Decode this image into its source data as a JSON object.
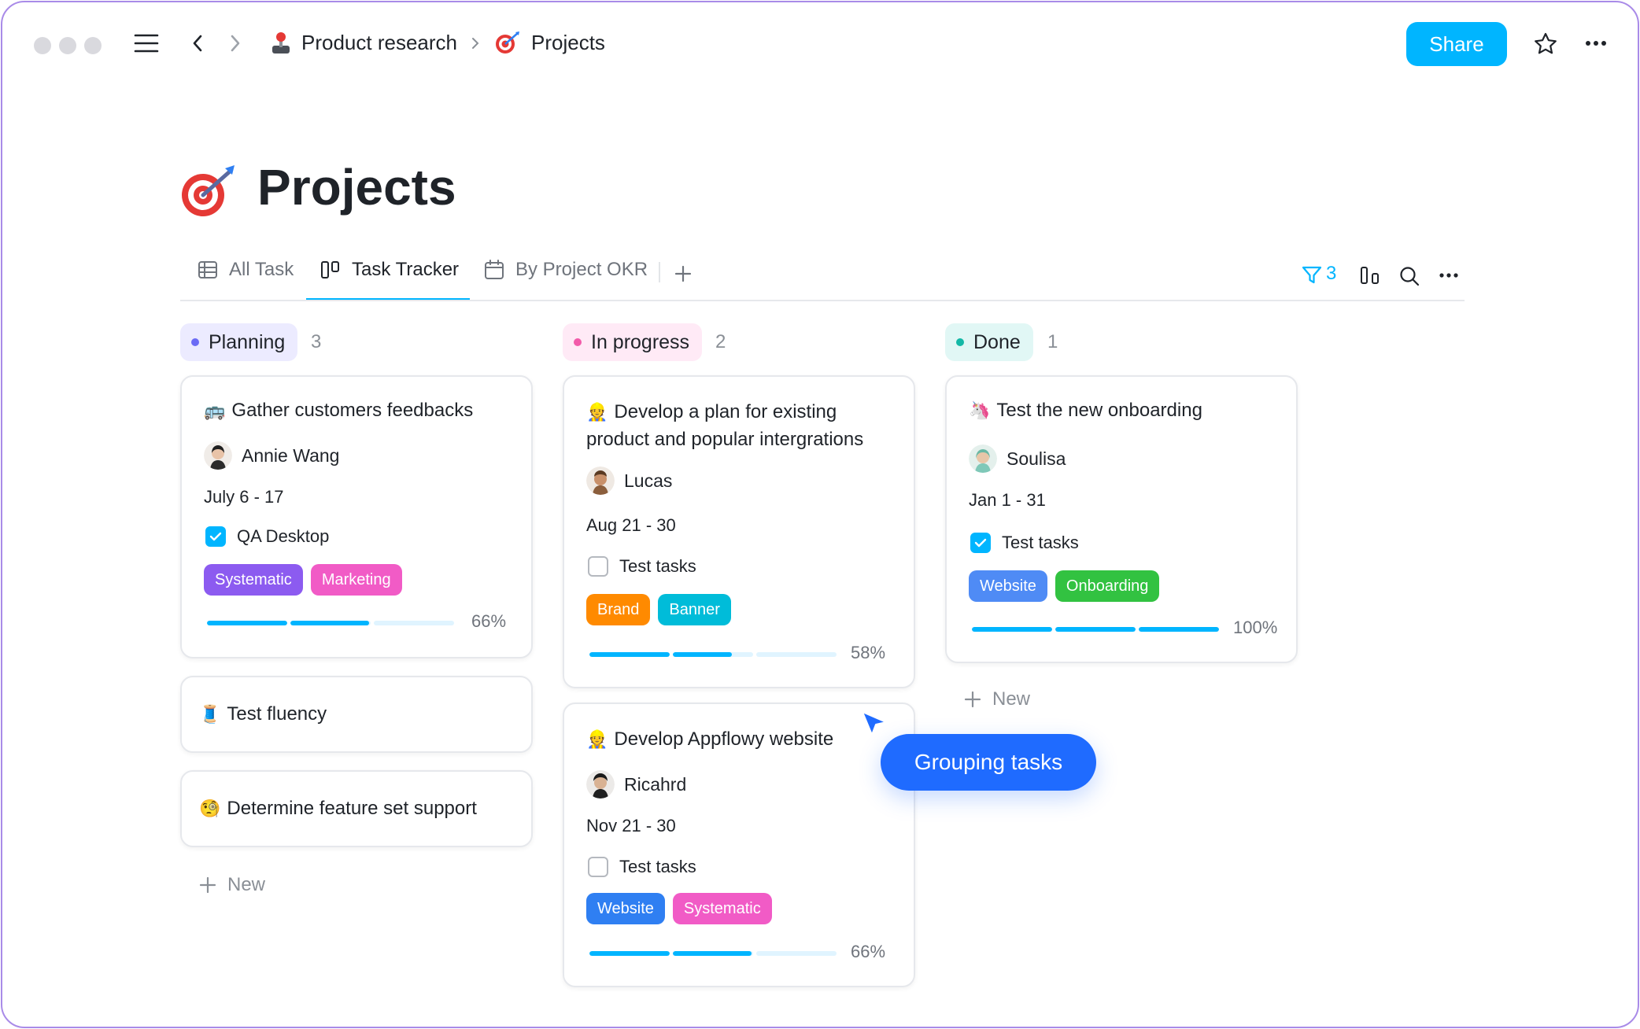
{
  "breadcrumb": {
    "parent": "Product research",
    "current": "Projects"
  },
  "header": {
    "share_label": "Share"
  },
  "page": {
    "title": "Projects"
  },
  "tabs": [
    {
      "label": "All Task",
      "icon": "grid-icon"
    },
    {
      "label": "Task Tracker",
      "icon": "board-icon",
      "active": true
    },
    {
      "label": "By Project OKR",
      "icon": "calendar-icon"
    }
  ],
  "toolbar": {
    "filter_count": "3"
  },
  "colors": {
    "accent": "#00b5ff",
    "planning_bg": "#ecebff",
    "planning_dot": "#6b6bf5",
    "inprogress_bg": "#ffeaf6",
    "inprogress_dot": "#f25aa9",
    "done_bg": "#e1f7f5",
    "done_dot": "#14b8a6"
  },
  "columns": [
    {
      "name": "Planning",
      "count": "3",
      "cards": [
        {
          "emoji": "🚌",
          "title": "Gather customers feedbacks",
          "assignee": "Annie Wang",
          "date": "July 6 - 17",
          "checklist": {
            "label": "QA Desktop",
            "checked": true
          },
          "tags": [
            {
              "label": "Systematic",
              "color": "#8c5bf0"
            },
            {
              "label": "Marketing",
              "color": "#f15bc6"
            }
          ],
          "progress": 0.66,
          "progress_label": "66%"
        },
        {
          "emoji": "🧵",
          "title": "Test fluency"
        },
        {
          "emoji": "🧐",
          "title": "Determine feature set support"
        }
      ],
      "new_label": "New"
    },
    {
      "name": "In progress",
      "count": "2",
      "cards": [
        {
          "emoji": "👷",
          "title_line1": "Develop a plan for existing",
          "title_line2": "product and popular intergrations",
          "assignee": "Lucas",
          "date": "Aug 21 - 30",
          "checklist": {
            "label": "Test tasks",
            "checked": false
          },
          "tags": [
            {
              "label": "Brand",
              "color": "#ff8a00"
            },
            {
              "label": "Banner",
              "color": "#00bcd9"
            }
          ],
          "progress": 0.58,
          "progress_label": "58%"
        },
        {
          "emoji": "👷",
          "title": "Develop Appflowy website",
          "assignee": "Ricahrd",
          "date": "Nov 21 - 30",
          "checklist": {
            "label": "Test tasks",
            "checked": false
          },
          "tags": [
            {
              "label": "Website",
              "color": "#2f7ff2"
            },
            {
              "label": "Systematic",
              "color": "#f15bc6"
            }
          ],
          "progress": 0.66,
          "progress_label": "66%"
        }
      ]
    },
    {
      "name": "Done",
      "count": "1",
      "cards": [
        {
          "emoji": "🦄",
          "title": "Test the new onboarding",
          "assignee": "Soulisa",
          "date": "Jan 1 - 31",
          "checklist": {
            "label": "Test tasks",
            "checked": true
          },
          "tags": [
            {
              "label": "Website",
              "color": "#4f8bf5"
            },
            {
              "label": "Onboarding",
              "color": "#32c241"
            }
          ],
          "progress": 1.0,
          "progress_label": "100%"
        }
      ],
      "new_label": "New"
    }
  ],
  "tooltip": {
    "label": "Grouping tasks"
  }
}
